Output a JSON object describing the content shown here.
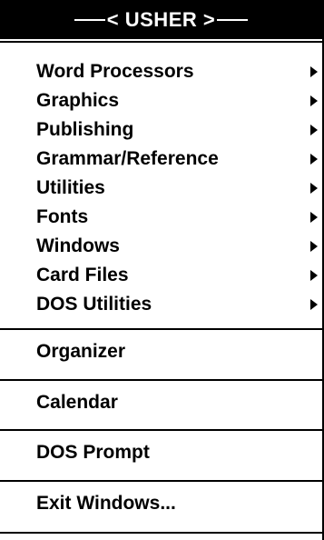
{
  "menu": {
    "title": "< USHER >",
    "submenu_items": [
      {
        "label": "Word Processors",
        "icon": "submenu-arrow-icon"
      },
      {
        "label": "Graphics",
        "icon": "submenu-arrow-icon"
      },
      {
        "label": "Publishing",
        "icon": "submenu-arrow-icon"
      },
      {
        "label": "Grammar/Reference",
        "icon": "submenu-arrow-icon"
      },
      {
        "label": "Utilities",
        "icon": "submenu-arrow-icon"
      },
      {
        "label": "Fonts",
        "icon": "submenu-arrow-icon"
      },
      {
        "label": "Windows",
        "icon": "submenu-arrow-icon"
      },
      {
        "label": "Card Files",
        "icon": "submenu-arrow-icon"
      },
      {
        "label": "DOS Utilities",
        "icon": "submenu-arrow-icon"
      }
    ],
    "action_items": [
      {
        "label": "Organizer"
      },
      {
        "label": "Calendar"
      },
      {
        "label": "DOS Prompt"
      },
      {
        "label": "Exit Windows..."
      }
    ]
  },
  "colors": {
    "title_background": "#000000",
    "title_text": "#ffffff",
    "menu_background": "#ffffff",
    "menu_text": "#000000"
  }
}
